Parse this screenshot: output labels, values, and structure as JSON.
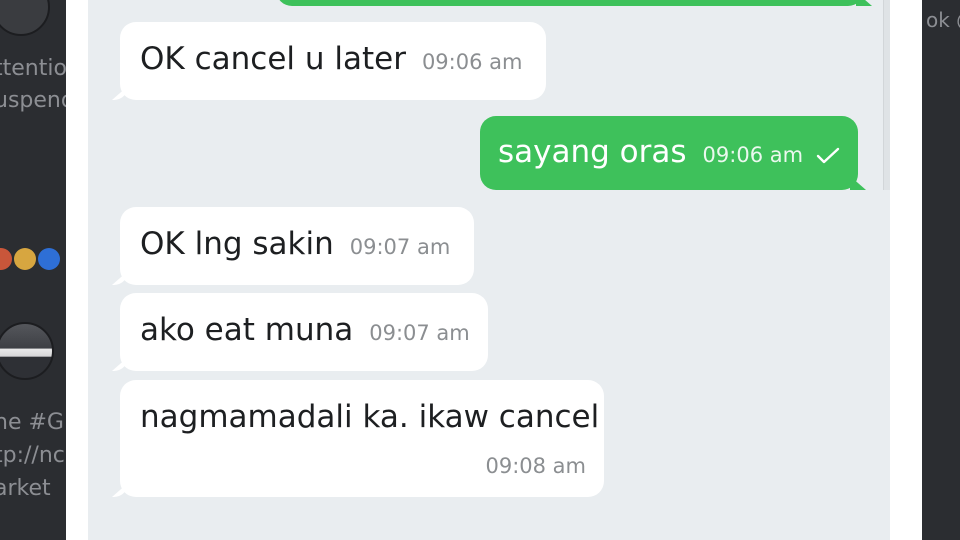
{
  "background": {
    "left_texts": [
      "ttentio",
      "uspend",
      "he #Gi",
      "tp://nc",
      "arket"
    ],
    "right_text": "ok @"
  },
  "colors": {
    "incoming_bubble": "#ffffff",
    "outgoing_bubble": "#3ec15b",
    "chat_background": "#e9edf0"
  },
  "messages": [
    {
      "direction": "out",
      "text": "",
      "time": ""
    },
    {
      "direction": "in",
      "text": "OK cancel u later",
      "time": "09:06 am"
    },
    {
      "direction": "out",
      "text": "sayang oras",
      "time": "09:06 am",
      "status_icon": "check-icon"
    },
    {
      "direction": "in",
      "text": "OK lng sakin",
      "time": "09:07 am"
    },
    {
      "direction": "in",
      "text": "ako eat muna",
      "time": "09:07 am"
    },
    {
      "direction": "in",
      "text": "nagmamadali ka. ikaw cancel",
      "time": "09:08 am"
    }
  ]
}
